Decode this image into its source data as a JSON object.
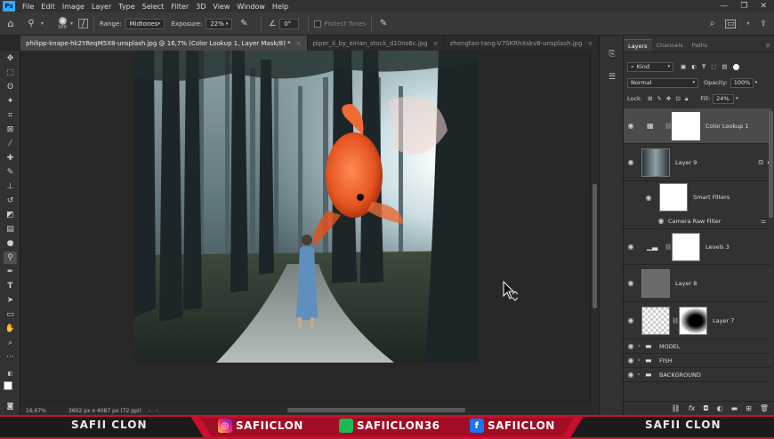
{
  "menu": {
    "logo": "Ps",
    "items": [
      "File",
      "Edit",
      "Image",
      "Layer",
      "Type",
      "Select",
      "Filter",
      "3D",
      "View",
      "Window",
      "Help"
    ],
    "window_buttons": [
      "—",
      "❐",
      "✕"
    ]
  },
  "options": {
    "brush_size": "100",
    "range_label": "Range:",
    "range_value": "Midtones",
    "exposure_label": "Exposure:",
    "exposure_value": "22%",
    "angle_value": "0°",
    "protect_tones": "Protect Tones"
  },
  "tabs": [
    {
      "label": "philipp-knape-hk2YReqM5X8-unsplash.jpg @ 16,7% (Color Lookup 1, Layer Mask/8) *",
      "active": true
    },
    {
      "label": "piper_ii_by_eirian_stock_d10ns6c.jpg",
      "active": false
    },
    {
      "label": "zhengtao-tang-V7SKRhXskv8-unsplash.jpg",
      "active": false
    }
  ],
  "status": {
    "zoom": "16,67%",
    "doc_info": "3602 px x 4087 px (72 ppi)"
  },
  "panel": {
    "tabs": [
      "Layers",
      "Channels",
      "Paths"
    ],
    "filter_label": "Kind",
    "blend_mode": "Normal",
    "opacity_label": "Opacity:",
    "opacity_value": "100%",
    "lock_label": "Lock:",
    "fill_label": "Fill:",
    "fill_value": "24%",
    "layers": [
      {
        "name": "Color Lookup 1"
      },
      {
        "name": "Layer 9"
      },
      {
        "name": "Smart Filters"
      },
      {
        "name": "Camera Raw Filter"
      },
      {
        "name": "Levels 3"
      },
      {
        "name": "Layer 8"
      },
      {
        "name": "Layer 7"
      },
      {
        "name": "MODEL"
      },
      {
        "name": "FISH"
      },
      {
        "name": "BACKGROUND"
      }
    ]
  },
  "banner": {
    "left_name": "SAFII CLON",
    "instagram": "SAFIICLON",
    "green": "SAFIICLON36",
    "facebook": "SAFIICLON",
    "right_name": "SAFII CLON"
  }
}
